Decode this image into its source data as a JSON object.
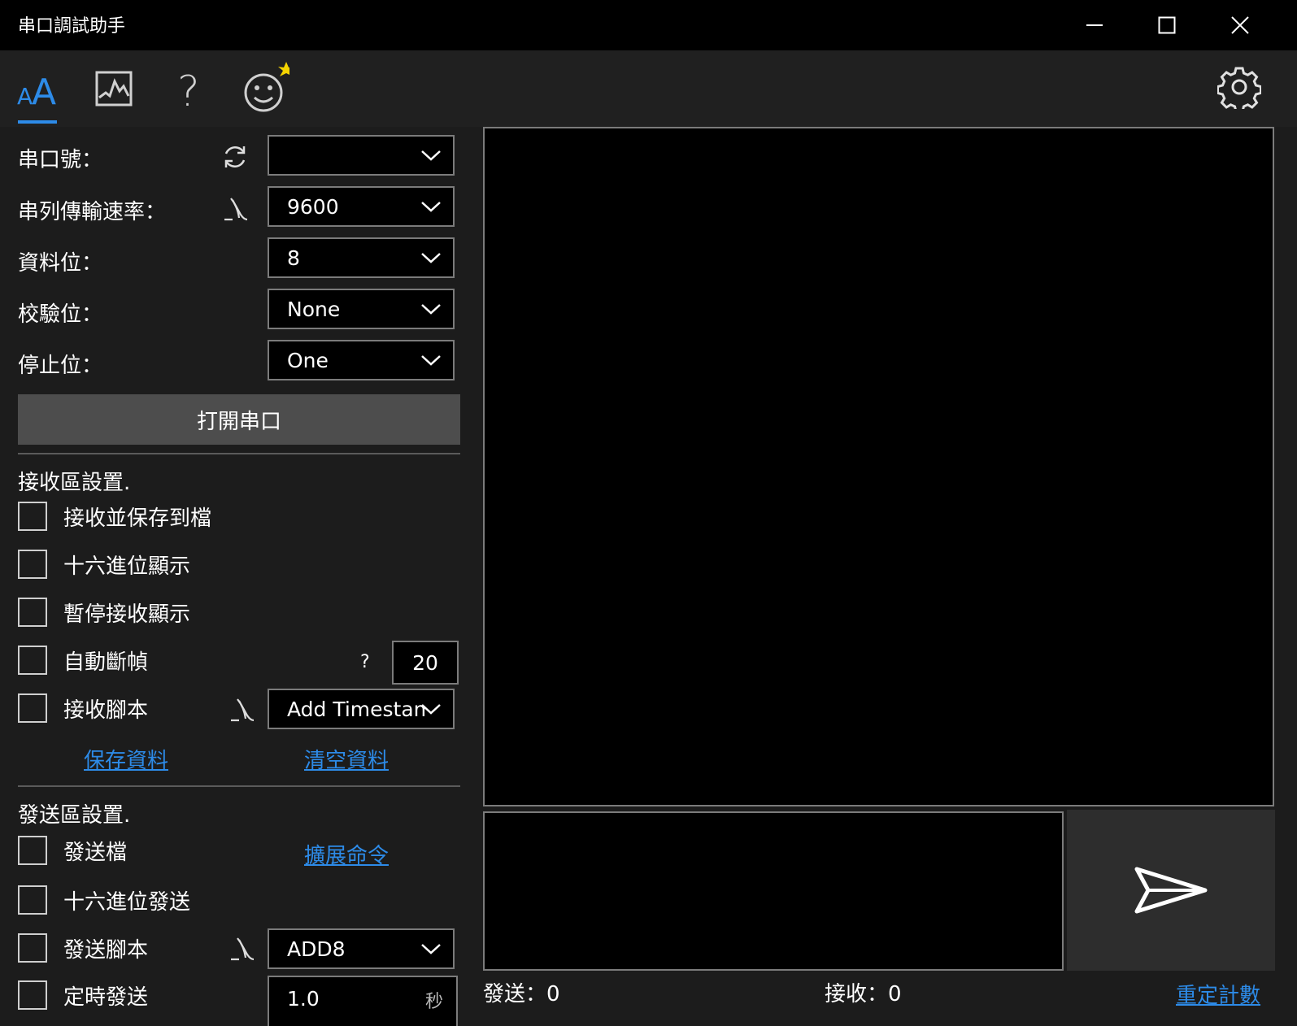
{
  "window": {
    "title": "串口調試助手"
  },
  "toolbar": {
    "tabs": [
      {
        "name": "font-size-icon"
      },
      {
        "name": "chart-icon"
      },
      {
        "name": "help-icon"
      },
      {
        "name": "smiley-icon"
      }
    ],
    "accent": "#2d8be8"
  },
  "serial": {
    "port_label": "串口號：",
    "port_value": "",
    "baud_label": "串列傳輸速率：",
    "baud_value": "9600",
    "databits_label": "資料位：",
    "databits_value": "8",
    "parity_label": "校驗位：",
    "parity_value": "None",
    "stopbits_label": "停止位：",
    "stopbits_value": "One",
    "open_button": "打開串口"
  },
  "receive": {
    "section_title": "接收區設置.",
    "save_to_file": "接收並保存到檔",
    "hex_display": "十六進位顯示",
    "pause_display": "暫停接收顯示",
    "auto_frame": "自動斷幀",
    "auto_frame_help": "?",
    "auto_frame_value": "20",
    "script_label": "接收腳本",
    "script_value": "Add Timestamp",
    "save_link": "保存資料",
    "clear_link": "清空資料"
  },
  "send": {
    "section_title": "發送區設置.",
    "send_file": "發送檔",
    "extend_link": "擴展命令",
    "hex_send": "十六進位發送",
    "script_label": "發送腳本",
    "script_value": "ADD8",
    "timed_send": "定時發送",
    "timed_value": "1.0",
    "timed_unit": "秒"
  },
  "status": {
    "sent": "發送：0",
    "received": "接收：0",
    "reset_link": "重定計數"
  }
}
